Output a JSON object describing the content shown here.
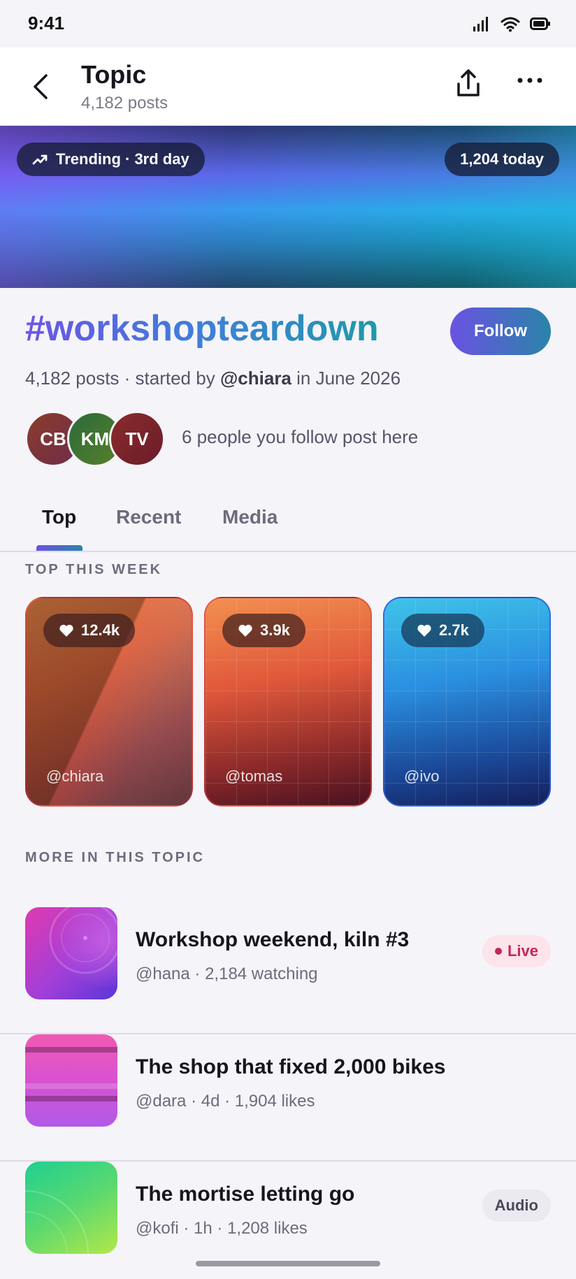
{
  "status": {
    "time": "9:41"
  },
  "header": {
    "title": "Topic",
    "subtitle": "4,182 posts"
  },
  "hero": {
    "trending": "Trending · 3rd day",
    "today": "1,204 today"
  },
  "topic": {
    "hashtag": "#workshopteardown",
    "follow_label": "Follow",
    "meta_prefix": "4,182 posts · started by ",
    "meta_user": "@chiara",
    "meta_suffix": " in June 2026",
    "followers": [
      "CB",
      "KM",
      "TV"
    ],
    "followers_note": "6 people you follow post here"
  },
  "tabs": [
    {
      "label": "Top",
      "active": true
    },
    {
      "label": "Recent",
      "active": false
    },
    {
      "label": "Media",
      "active": false
    }
  ],
  "top_week": {
    "heading": "TOP THIS WEEK",
    "cards": [
      {
        "likes": "12.4k",
        "handle": "@chiara"
      },
      {
        "likes": "3.9k",
        "handle": "@tomas"
      },
      {
        "likes": "2.7k",
        "handle": "@ivo"
      }
    ]
  },
  "more": {
    "heading": "MORE IN THIS TOPIC",
    "items": [
      {
        "title": "Workshop weekend, kiln #3",
        "sub": "@hana · 2,184 watching",
        "badge": "Live"
      },
      {
        "title": "The shop that fixed 2,000 bikes",
        "sub": "@dara · 4d · 1,904 likes",
        "badge": ""
      },
      {
        "title": "The mortise letting go",
        "sub": "@kofi · 1h · 1,208 likes",
        "badge": "Audio"
      }
    ]
  }
}
